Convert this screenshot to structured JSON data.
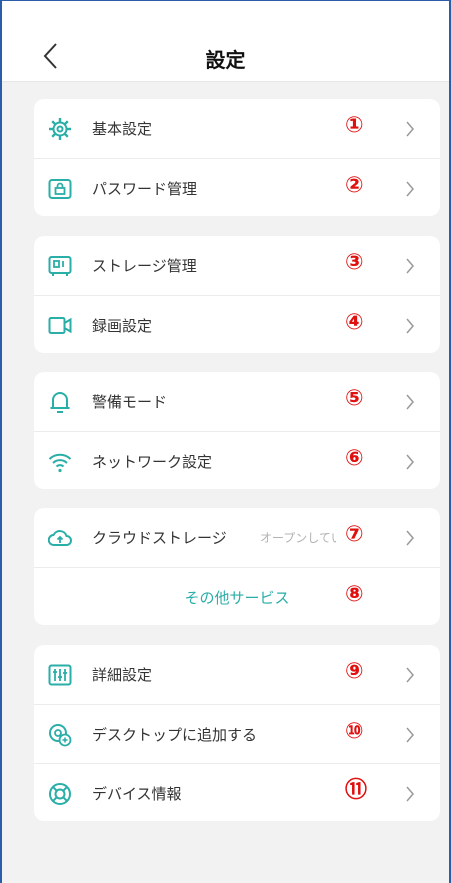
{
  "header": {
    "title": "設定",
    "back_icon": "chevron-left-icon"
  },
  "colors": {
    "accent": "#2aaea8",
    "marker": "#e01010",
    "chevron": "#999999",
    "background": "#f2f2f2"
  },
  "groups": [
    {
      "items": [
        {
          "icon": "gear-icon",
          "label": "基本設定",
          "marker": "①"
        },
        {
          "icon": "lock-icon",
          "label": "パスワード管理",
          "marker": "②"
        }
      ]
    },
    {
      "items": [
        {
          "icon": "storage-icon",
          "label": "ストレージ管理",
          "marker": "③"
        },
        {
          "icon": "video-camera-icon",
          "label": "録画設定",
          "marker": "④"
        }
      ]
    },
    {
      "items": [
        {
          "icon": "bell-icon",
          "label": "警備モード",
          "marker": "⑤"
        },
        {
          "icon": "wifi-icon",
          "label": "ネットワーク設定",
          "marker": "⑥"
        }
      ]
    },
    {
      "items": [
        {
          "icon": "cloud-upload-icon",
          "label": "クラウドストレージ",
          "status": "オープンしていません",
          "marker": "⑦"
        }
      ],
      "link": {
        "label": "その他サービス",
        "marker": "⑧"
      }
    },
    {
      "items": [
        {
          "icon": "sliders-icon",
          "label": "詳細設定",
          "marker": "⑨"
        },
        {
          "icon": "add-to-desktop-icon",
          "label": "デスクトップに追加する",
          "marker": "⑩"
        },
        {
          "icon": "lifebuoy-icon",
          "label": "デバイス情報",
          "marker": "⑪"
        }
      ]
    }
  ]
}
